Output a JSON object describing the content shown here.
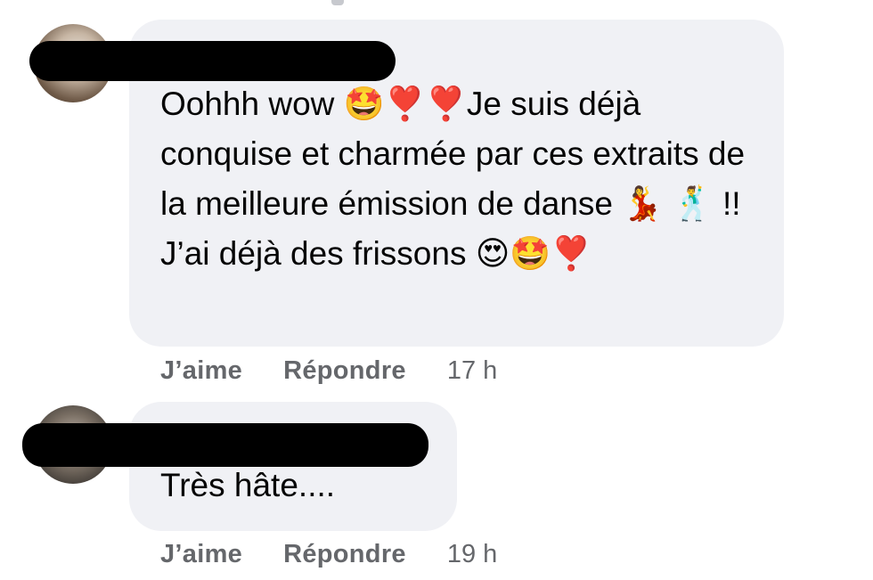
{
  "comments": [
    {
      "author": "",
      "text": "Oohhh wow 🤩❣️❣️Je suis déjà conquise et charmée par ces extraits de la meilleure émission de danse 💃 🕺 !! J’ai déjà des frissons 😍🤩❣️",
      "actions": {
        "like_label": "J’aime",
        "reply_label": "Répondre"
      },
      "timestamp": "17 h"
    },
    {
      "author": "",
      "text": "Très hâte....",
      "actions": {
        "like_label": "J’aime",
        "reply_label": "Répondre"
      },
      "timestamp": "19 h"
    }
  ],
  "colors": {
    "bubble_background": "#f0f1f5",
    "text": "#050505",
    "secondary_text": "#65676b",
    "redaction": "#000000"
  }
}
